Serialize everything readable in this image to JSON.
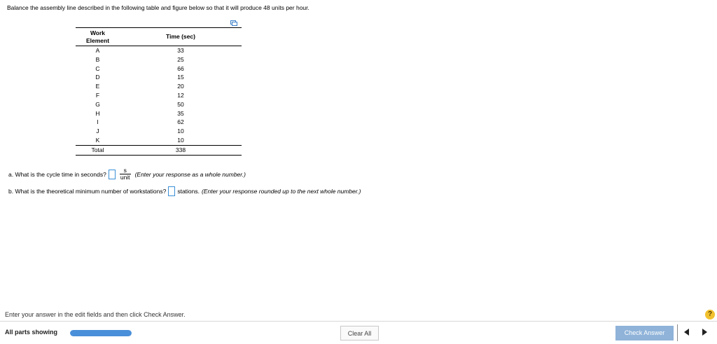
{
  "question": {
    "prompt": "Balance the assembly line described in the following table and figure below so that it will produce 48 units per hour."
  },
  "table": {
    "header_col1_line1": "Work",
    "header_col1_line2": "Element",
    "header_col2": "Time (sec)",
    "rows": [
      {
        "element": "A",
        "time": "33"
      },
      {
        "element": "B",
        "time": "25"
      },
      {
        "element": "C",
        "time": "66"
      },
      {
        "element": "D",
        "time": "15"
      },
      {
        "element": "E",
        "time": "20"
      },
      {
        "element": "F",
        "time": "12"
      },
      {
        "element": "G",
        "time": "50"
      },
      {
        "element": "H",
        "time": "35"
      },
      {
        "element": "I",
        "time": "62"
      },
      {
        "element": "J",
        "time": "10"
      },
      {
        "element": "K",
        "time": "10"
      }
    ],
    "total_label": "Total",
    "total_value": "338"
  },
  "part_a": {
    "question": "a. What is the cycle time in seconds?",
    "unit_numerator": "s",
    "unit_denominator": "unit",
    "hint": "(Enter your response as a whole number.)"
  },
  "part_b": {
    "question": "b. What is the theoretical minimum number of workstations?",
    "unit": "stations.",
    "hint": "(Enter your response rounded up to the next whole number.)"
  },
  "footer": {
    "instruction": "Enter your answer in the edit fields and then click Check Answer.",
    "help_symbol": "?",
    "all_parts_label": "All parts showing",
    "progress_fraction": 1.0,
    "clear_label": "Clear All",
    "check_label": "Check Answer"
  },
  "colors": {
    "accent": "#4a8fd9",
    "check_button": "#8fb3d9",
    "help": "#f2c12e"
  }
}
